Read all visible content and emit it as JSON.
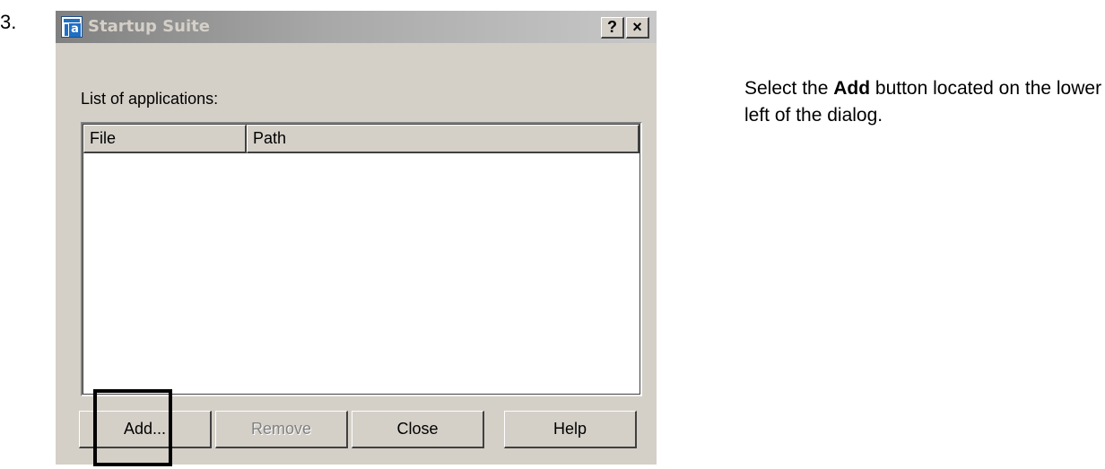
{
  "step": {
    "number": "3."
  },
  "dialog": {
    "title": "Startup Suite",
    "help_glyph": "?",
    "close_glyph": "×",
    "icon": "app-logo-icon",
    "icon_letter": "a",
    "list_label": "List of applications:",
    "columns": [
      {
        "label": "File"
      },
      {
        "label": "Path"
      }
    ],
    "rows": [],
    "buttons": {
      "add": "Add...",
      "remove": "Remove",
      "close": "Close",
      "help": "Help"
    }
  },
  "instruction": {
    "prefix": "Select the ",
    "emphasis": "Add",
    "suffix": " button located on the lower left of the dialog."
  },
  "colors": {
    "dialog_bg": "#d4d0c8",
    "title_gradient_start": "#808080",
    "title_gradient_end": "#c8c8c8",
    "highlight": "#000000",
    "icon_blue": "#1f6fc4"
  }
}
